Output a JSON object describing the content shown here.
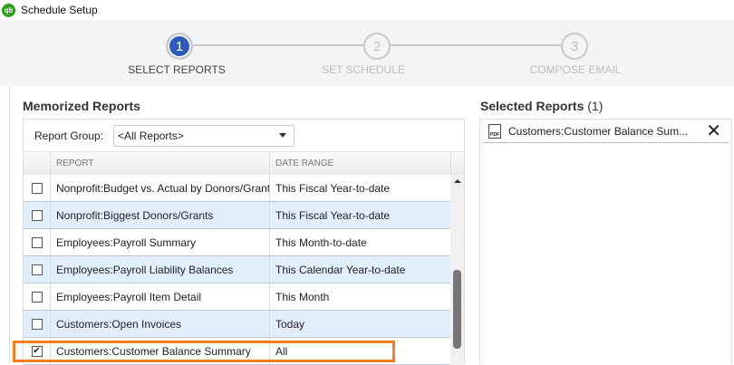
{
  "window": {
    "title": "Schedule Setup",
    "logo": "qb"
  },
  "stepper": {
    "steps": [
      {
        "number": "1",
        "label": "SELECT REPORTS",
        "active": true
      },
      {
        "number": "2",
        "label": "SET SCHEDULE",
        "active": false
      },
      {
        "number": "3",
        "label": "COMPOSE EMAIL",
        "active": false
      }
    ]
  },
  "memorized": {
    "title": "Memorized Reports",
    "group_label": "Report Group:",
    "group_value": "<All Reports>",
    "columns": [
      "REPORT",
      "DATE RANGE"
    ],
    "rows": [
      {
        "report": "Nonprofit:Budget vs. Actual by Donors/Grants",
        "range": "This Fiscal Year-to-date",
        "checked": false
      },
      {
        "report": "Nonprofit:Biggest Donors/Grants",
        "range": "This Fiscal Year-to-date",
        "checked": false
      },
      {
        "report": "Employees:Payroll Summary",
        "range": "This Month-to-date",
        "checked": false
      },
      {
        "report": "Employees:Payroll Liability Balances",
        "range": "This Calendar Year-to-date",
        "checked": false
      },
      {
        "report": "Employees:Payroll Item Detail",
        "range": "This Month",
        "checked": false
      },
      {
        "report": "Customers:Open Invoices",
        "range": "Today",
        "checked": false
      },
      {
        "report": "Customers:Customer Balance Summary",
        "range": "All",
        "checked": true
      }
    ]
  },
  "selected": {
    "title": "Selected Reports",
    "count": "(1)",
    "items": [
      {
        "name": "Customers:Customer Balance Sum...",
        "icon": "pdf-icon"
      }
    ]
  },
  "colors": {
    "accent": "#2f5cb7",
    "highlight": "#f57f20",
    "row_alt": "#e3eefc"
  }
}
